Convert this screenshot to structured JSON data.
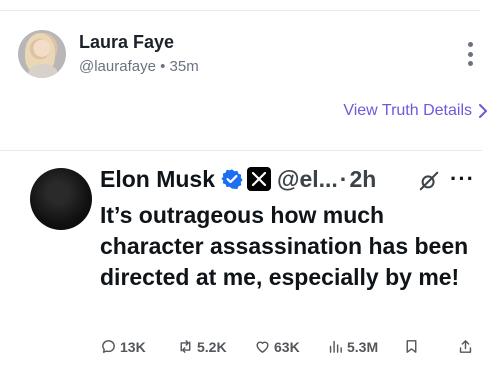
{
  "truth_post": {
    "author_name": "Laura Faye",
    "author_handle": "@laurafaye",
    "separator": "•",
    "age": "35m",
    "details_link": "View Truth Details"
  },
  "embedded_post": {
    "author_name": "Elon Musk",
    "author_handle": "@el...",
    "separator": "·",
    "age": "2h",
    "more_glyph": "···",
    "text": "It’s outrageous how much character assassination has been directed at me, especially by me!",
    "actions": {
      "replies": "13K",
      "reposts": "5.2K",
      "likes": "63K",
      "views": "5.3M"
    }
  },
  "colors": {
    "link": "#6d5ad9",
    "verified": "#1d6ff2",
    "muted": "#6b7280"
  }
}
